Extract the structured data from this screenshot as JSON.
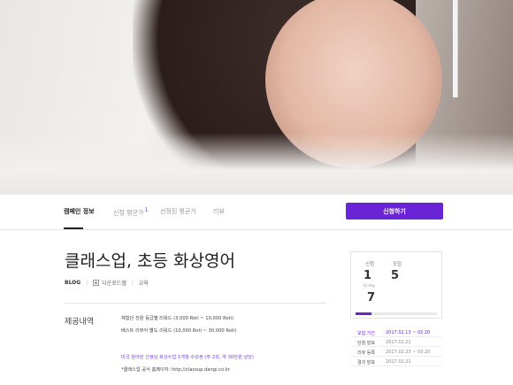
{
  "tabs": [
    {
      "label": "캠페인 정보",
      "count": ""
    },
    {
      "label": "신청 평균가",
      "count": "1"
    },
    {
      "label": "선정된 평균가",
      "count": ""
    },
    {
      "label": "리뷰",
      "count": ""
    }
  ],
  "apply_button": "신청하기",
  "campaign": {
    "title": "클래스업, 초등 화상영어",
    "blog_label": "BLOG",
    "owner": "다운로드헬",
    "category": "교육"
  },
  "provide": {
    "label": "제공내역",
    "lines": [
      "체험단 전원 등급별 리워드 (3,000 Roti ~ 10,000 Roti)",
      "베스트 리뷰어 별도 리워드 (10,000 Roti ~ 30,000 Roti)",
      "미국 원어민 선생님 화상수업 1개월 수강권 (주 2회, 약 30만원 상당)",
      "*클래스업 공식 홈페이지: http://classup.dangi.co.kr"
    ]
  },
  "stats": {
    "apply_label": "신청",
    "apply_value": "1",
    "recruit_label": "모집",
    "recruit_value": "5",
    "dday_label": "D-day",
    "dday_value": "7",
    "progress": 0.2
  },
  "schedule": [
    {
      "key": "모집 기간",
      "value": "2017.02.13 ~ 02.20"
    },
    {
      "key": "당첨 발표",
      "value": "2017.02.22"
    },
    {
      "key": "리뷰 등록",
      "value": "2017.02.23 ~ 03.20"
    },
    {
      "key": "결과 발표",
      "value": "2017.02.21"
    }
  ],
  "colors": {
    "accent": "#6a24d8"
  }
}
